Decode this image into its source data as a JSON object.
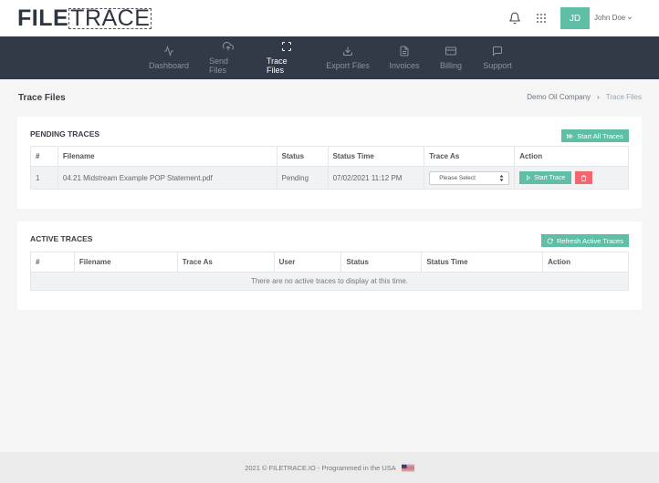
{
  "brand": {
    "part1": "FILE",
    "part2": "TRACE"
  },
  "header": {
    "avatar_initials": "JD",
    "user_name": "John Doe"
  },
  "nav": [
    {
      "label": "Dashboard",
      "icon": "activity-icon",
      "active": false
    },
    {
      "label": "Send Files",
      "icon": "cloud-upload-icon",
      "active": false
    },
    {
      "label": "Trace Files",
      "icon": "maximize-icon",
      "active": true
    },
    {
      "label": "Export Files",
      "icon": "download-icon",
      "active": false
    },
    {
      "label": "Invoices",
      "icon": "file-text-icon",
      "active": false
    },
    {
      "label": "Billing",
      "icon": "credit-card-icon",
      "active": false
    },
    {
      "label": "Support",
      "icon": "message-square-icon",
      "active": false
    }
  ],
  "page": {
    "title": "Trace Files",
    "breadcrumb": [
      "Demo Oil Company",
      "Trace Files"
    ]
  },
  "pending": {
    "title": "PENDING TRACES",
    "start_all_label": "Start All Traces",
    "columns": [
      "#",
      "Filename",
      "Status",
      "Status Time",
      "Trace As",
      "Action"
    ],
    "rows": [
      {
        "num": "1",
        "filename": "04.21 Midstream Example POP Statement.pdf",
        "status": "Pending",
        "status_time": "07/02/2021 11:12 PM",
        "trace_as": "Please Select",
        "start_label": "Start Trace"
      }
    ]
  },
  "active": {
    "title": "ACTIVE TRACES",
    "refresh_label": "Refresh Active Traces",
    "columns": [
      "#",
      "Filename",
      "Trace As",
      "User",
      "Status",
      "Status Time",
      "Action"
    ],
    "empty_message": "There are no active traces to display at this time."
  },
  "footer": {
    "text": "2021 © FILETRACE.IO - Programmed in the USA"
  },
  "colors": {
    "accent": "#5fbfa6",
    "nav_bg": "#313a46",
    "danger": "#f2676f"
  }
}
